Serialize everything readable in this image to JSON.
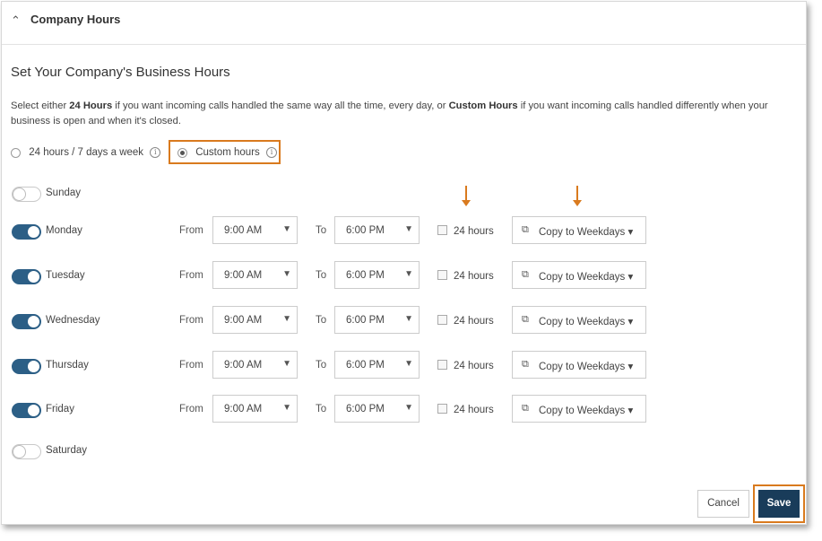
{
  "header": {
    "title": "Company Hours"
  },
  "section_title": "Set Your Company's Business Hours",
  "description": {
    "part1": "Select either ",
    "bold1": "24 Hours",
    "part2": " if you want incoming calls handled the same way all the time, every day, or ",
    "bold2": "Custom Hours",
    "part3": " if you want incoming calls handled differently when your business is open and when it's closed."
  },
  "options": {
    "always_label": "24 hours / 7 days a week",
    "custom_label": "Custom hours",
    "selected": "Custom hours"
  },
  "labels": {
    "from": "From",
    "to": "To",
    "all_day": "24 hours",
    "copy": "Copy to Weekdays"
  },
  "days": [
    {
      "name": "Sunday",
      "enabled": false
    },
    {
      "name": "Monday",
      "enabled": true,
      "from": "9:00 AM",
      "to": "6:00 PM"
    },
    {
      "name": "Tuesday",
      "enabled": true,
      "from": "9:00 AM",
      "to": "6:00 PM"
    },
    {
      "name": "Wednesday",
      "enabled": true,
      "from": "9:00 AM",
      "to": "6:00 PM"
    },
    {
      "name": "Thursday",
      "enabled": true,
      "from": "9:00 AM",
      "to": "6:00 PM"
    },
    {
      "name": "Friday",
      "enabled": true,
      "from": "9:00 AM",
      "to": "6:00 PM"
    },
    {
      "name": "Saturday",
      "enabled": false
    }
  ],
  "footer": {
    "cancel_label": "Cancel",
    "save_label": "Save"
  },
  "colors": {
    "accent": "#d97a1e",
    "toggle_on": "#2c5f86",
    "save_bg": "#193c5a"
  },
  "icons": {
    "collapse": "chevron-up-icon",
    "info": "info-icon",
    "copy": "copy-icon",
    "dropdown": "caret-down-icon"
  }
}
